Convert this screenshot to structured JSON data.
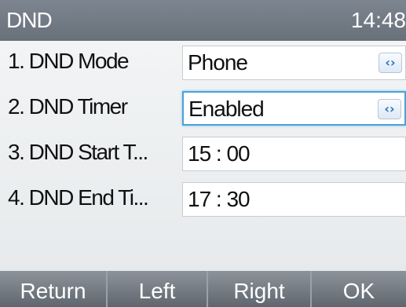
{
  "header": {
    "title": "DND",
    "time": "14:48"
  },
  "settings": {
    "items": [
      {
        "label": "1. DND Mode",
        "value": "Phone",
        "type": "select",
        "selector_icon": "left-right-arrows-icon"
      },
      {
        "label": "2. DND Timer",
        "value": "Enabled",
        "type": "select",
        "selector_icon": "left-right-arrows-icon",
        "focused": true
      },
      {
        "label": "3. DND Start T...",
        "value": "15 : 00",
        "type": "time"
      },
      {
        "label": "4. DND End Ti...",
        "value": "17 : 30",
        "type": "time"
      }
    ]
  },
  "softkeys": {
    "return_label": "Return",
    "left_label": "Left",
    "right_label": "Right",
    "ok_label": "OK"
  },
  "colors": {
    "focus_border": "#4aa3d8",
    "header_bg": "#737b84",
    "softkey_bg": "#757c84"
  }
}
